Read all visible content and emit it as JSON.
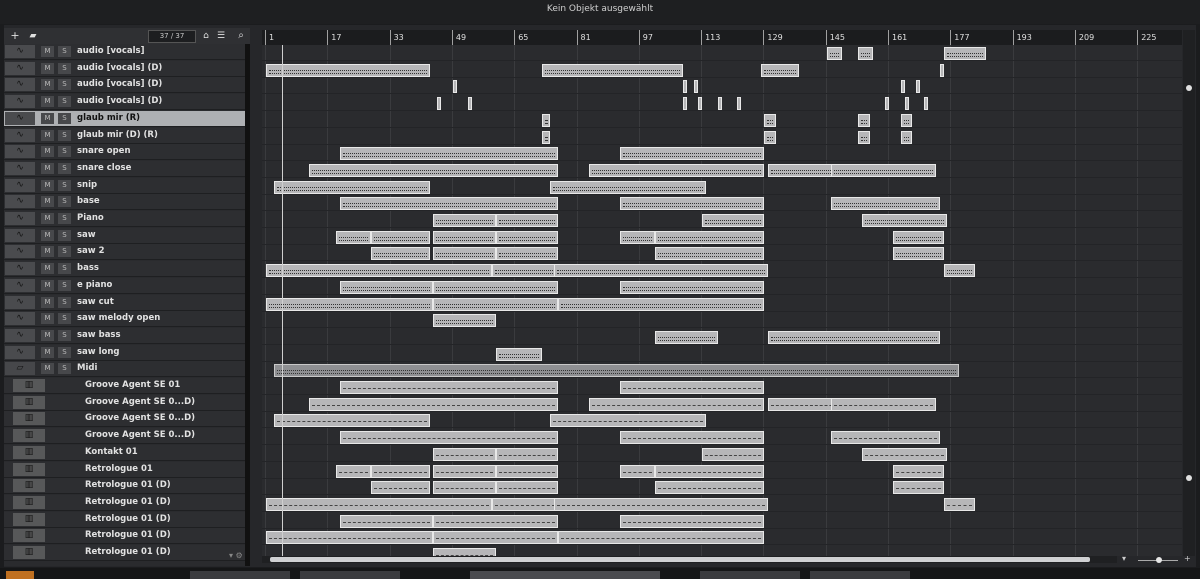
{
  "window": {
    "title": "Kein Objekt ausgewählt"
  },
  "toolbar": {
    "add_icon": "plus-icon",
    "folder_icon": "folder-icon",
    "track_count": "37 / 37",
    "search_icon": "search-icon"
  },
  "tracks": [
    {
      "name": "audio [vocals]",
      "type": "audio"
    },
    {
      "name": "audio [vocals] (D)",
      "type": "audio"
    },
    {
      "name": "audio [vocals] (D)",
      "type": "audio"
    },
    {
      "name": "audio [vocals] (D)",
      "type": "audio"
    },
    {
      "name": "glaub mir (R)",
      "type": "audio",
      "selected": true
    },
    {
      "name": "glaub mir (D) (R)",
      "type": "audio"
    },
    {
      "name": "snare open",
      "type": "audio"
    },
    {
      "name": "snare  close",
      "type": "audio"
    },
    {
      "name": "snip",
      "type": "audio"
    },
    {
      "name": "base",
      "type": "audio"
    },
    {
      "name": "Piano",
      "type": "audio"
    },
    {
      "name": "saw",
      "type": "audio"
    },
    {
      "name": "saw 2",
      "type": "audio"
    },
    {
      "name": "bass",
      "type": "audio"
    },
    {
      "name": "e piano",
      "type": "audio"
    },
    {
      "name": "saw cut",
      "type": "audio"
    },
    {
      "name": "saw melody open",
      "type": "audio"
    },
    {
      "name": "saw bass",
      "type": "audio"
    },
    {
      "name": "saw long",
      "type": "audio"
    },
    {
      "name": "Midi",
      "type": "folder"
    },
    {
      "name": "Groove Agent SE 01",
      "type": "instrument"
    },
    {
      "name": "Groove Agent SE 0...D)",
      "type": "instrument"
    },
    {
      "name": "Groove Agent SE 0...D)",
      "type": "instrument"
    },
    {
      "name": "Groove Agent SE 0...D)",
      "type": "instrument"
    },
    {
      "name": "Kontakt 01",
      "type": "instrument"
    },
    {
      "name": "Retrologue 01",
      "type": "instrument"
    },
    {
      "name": "Retrologue 01 (D)",
      "type": "instrument"
    },
    {
      "name": "Retrologue 01 (D)",
      "type": "instrument"
    },
    {
      "name": "Retrologue 01 (D)",
      "type": "instrument"
    },
    {
      "name": "Retrologue 01 (D)",
      "type": "instrument"
    },
    {
      "name": "Retrologue 01 (D)",
      "type": "instrument"
    }
  ],
  "labels": {
    "mute": "M",
    "solo": "S"
  },
  "ruler": {
    "bars": [
      1,
      17,
      33,
      49,
      65,
      81,
      97,
      113,
      129,
      145,
      161,
      177,
      193,
      209,
      225
    ]
  },
  "clips": [
    [
      [
        145,
        149
      ],
      [
        153,
        157
      ],
      [
        175,
        186
      ]
    ],
    [
      [
        1,
        43
      ],
      [
        72,
        108
      ],
      [
        128,
        138
      ],
      [
        174,
        175
      ]
    ],
    [
      [
        49,
        50
      ],
      [
        108,
        109
      ],
      [
        111,
        112
      ],
      [
        164,
        165
      ],
      [
        168,
        169
      ]
    ],
    [
      [
        45,
        46
      ],
      [
        53,
        54
      ],
      [
        108,
        109
      ],
      [
        112,
        113
      ],
      [
        117,
        118
      ],
      [
        122,
        123
      ],
      [
        160,
        161
      ],
      [
        165,
        166
      ],
      [
        170,
        171
      ]
    ],
    [
      [
        72,
        74
      ],
      [
        129,
        132
      ],
      [
        153,
        156
      ],
      [
        164,
        167
      ]
    ],
    [
      [
        72,
        74
      ],
      [
        129,
        132
      ],
      [
        153,
        156
      ],
      [
        164,
        167
      ]
    ],
    [
      [
        20,
        76
      ],
      [
        92,
        129
      ]
    ],
    [
      [
        12,
        76
      ],
      [
        84,
        129
      ],
      [
        130,
        151
      ],
      [
        146,
        173
      ]
    ],
    [
      [
        3,
        43
      ],
      [
        74,
        114
      ]
    ],
    [
      [
        20,
        76
      ],
      [
        92,
        129
      ],
      [
        146,
        174
      ]
    ],
    [
      [
        44,
        60
      ],
      [
        60,
        76
      ],
      [
        113,
        129
      ],
      [
        154,
        176
      ]
    ],
    [
      [
        19,
        28
      ],
      [
        28,
        43
      ],
      [
        44,
        60
      ],
      [
        60,
        76
      ],
      [
        92,
        101
      ],
      [
        101,
        129
      ],
      [
        162,
        175
      ]
    ],
    [
      [
        28,
        43
      ],
      [
        44,
        60
      ],
      [
        60,
        76
      ],
      [
        101,
        129
      ],
      [
        162,
        175
      ]
    ],
    [
      [
        1,
        59
      ],
      [
        59,
        76
      ],
      [
        75,
        130
      ],
      [
        175,
        183
      ]
    ],
    [
      [
        20,
        44
      ],
      [
        44,
        76
      ],
      [
        92,
        129
      ]
    ],
    [
      [
        1,
        44
      ],
      [
        44,
        76
      ],
      [
        76,
        129
      ]
    ],
    [
      [
        44,
        60
      ]
    ],
    [
      [
        101,
        117
      ],
      [
        130,
        174
      ]
    ],
    [
      [
        60,
        72
      ]
    ],
    [
      [
        3,
        179
      ]
    ],
    [
      [
        20,
        76
      ],
      [
        92,
        129
      ]
    ],
    [
      [
        12,
        76
      ],
      [
        84,
        129
      ],
      [
        130,
        151
      ],
      [
        146,
        173
      ]
    ],
    [
      [
        3,
        43
      ],
      [
        74,
        114
      ]
    ],
    [
      [
        20,
        76
      ],
      [
        92,
        129
      ],
      [
        146,
        174
      ]
    ],
    [
      [
        44,
        60
      ],
      [
        60,
        76
      ],
      [
        113,
        129
      ],
      [
        154,
        176
      ]
    ],
    [
      [
        19,
        28
      ],
      [
        28,
        43
      ],
      [
        44,
        60
      ],
      [
        60,
        76
      ],
      [
        92,
        101
      ],
      [
        101,
        129
      ],
      [
        162,
        175
      ]
    ],
    [
      [
        28,
        43
      ],
      [
        44,
        60
      ],
      [
        60,
        76
      ],
      [
        101,
        129
      ],
      [
        162,
        175
      ]
    ],
    [
      [
        1,
        59
      ],
      [
        59,
        76
      ],
      [
        75,
        130
      ],
      [
        175,
        183
      ]
    ],
    [
      [
        20,
        44
      ],
      [
        44,
        76
      ],
      [
        92,
        129
      ]
    ],
    [
      [
        1,
        44
      ],
      [
        44,
        76
      ],
      [
        76,
        129
      ]
    ],
    [
      [
        44,
        60
      ]
    ]
  ]
}
